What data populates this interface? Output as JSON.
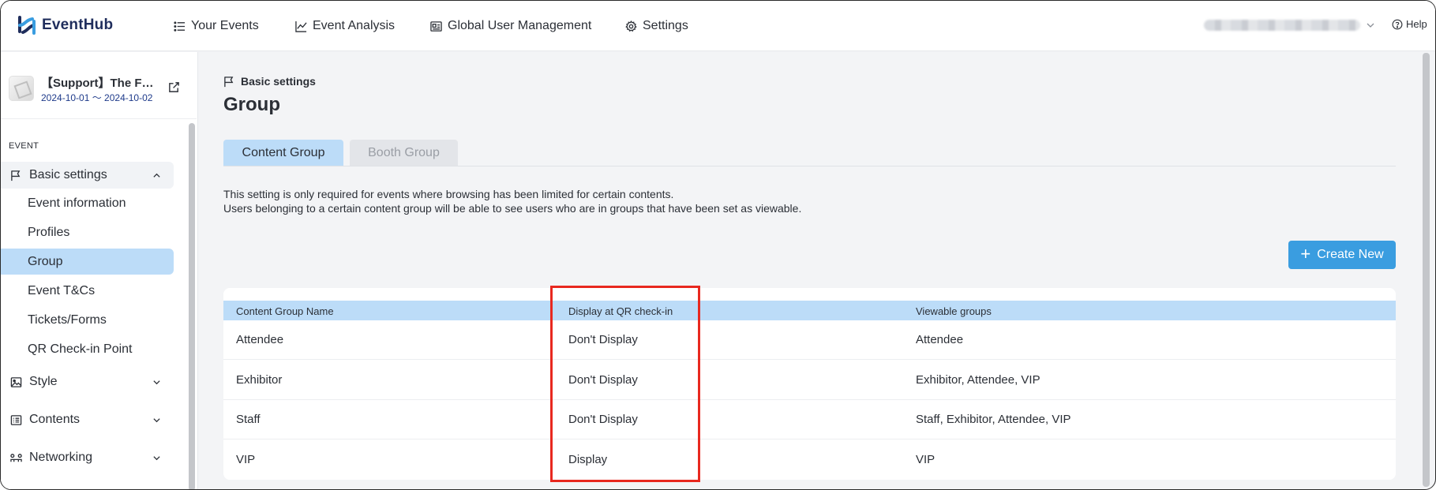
{
  "app": {
    "name": "EventHub"
  },
  "nav": [
    {
      "label": "Your Events",
      "icon": "list-icon"
    },
    {
      "label": "Event Analysis",
      "icon": "chart-line-icon"
    },
    {
      "label": "Global User Management",
      "icon": "id-card-icon"
    },
    {
      "label": "Settings",
      "icon": "gear-icon"
    }
  ],
  "help_label": "Help",
  "event": {
    "name": "【Support】The F…",
    "dates": "2024-10-01 ～ 2024-10-02"
  },
  "sidebar": {
    "section_label": "EVENT",
    "basic_settings": {
      "label": "Basic settings",
      "items": [
        "Event information",
        "Profiles",
        "Group",
        "Event T&Cs",
        "Tickets/Forms",
        "QR Check-in Point"
      ],
      "active": "Group"
    },
    "style": {
      "label": "Style"
    },
    "contents": {
      "label": "Contents"
    },
    "networking": {
      "label": "Networking"
    }
  },
  "breadcrumb": "Basic settings",
  "page_title": "Group",
  "tabs": [
    {
      "label": "Content Group",
      "active": true
    },
    {
      "label": "Booth Group",
      "active": false
    }
  ],
  "description": [
    "This setting is only required for events where browsing has been limited for certain contents.",
    "Users belonging to a certain content group will be able to see users who are in groups that have been set as viewable."
  ],
  "create_button": {
    "label": "Create New"
  },
  "table": {
    "headers": [
      "Content Group Name",
      "Display at QR check-in",
      "Viewable groups"
    ],
    "rows": [
      [
        "Attendee",
        "Don't Display",
        "Attendee"
      ],
      [
        "Exhibitor",
        "Don't Display",
        "Exhibitor, Attendee, VIP"
      ],
      [
        "Staff",
        "Don't Display",
        "Staff, Exhibitor, Attendee, VIP"
      ],
      [
        "VIP",
        "Display",
        "VIP"
      ]
    ]
  },
  "colors": {
    "accent": "#3a9de0",
    "selected_bg": "#bcdcf8",
    "highlight": "#e8281f",
    "brand": "#1f2d5c"
  }
}
